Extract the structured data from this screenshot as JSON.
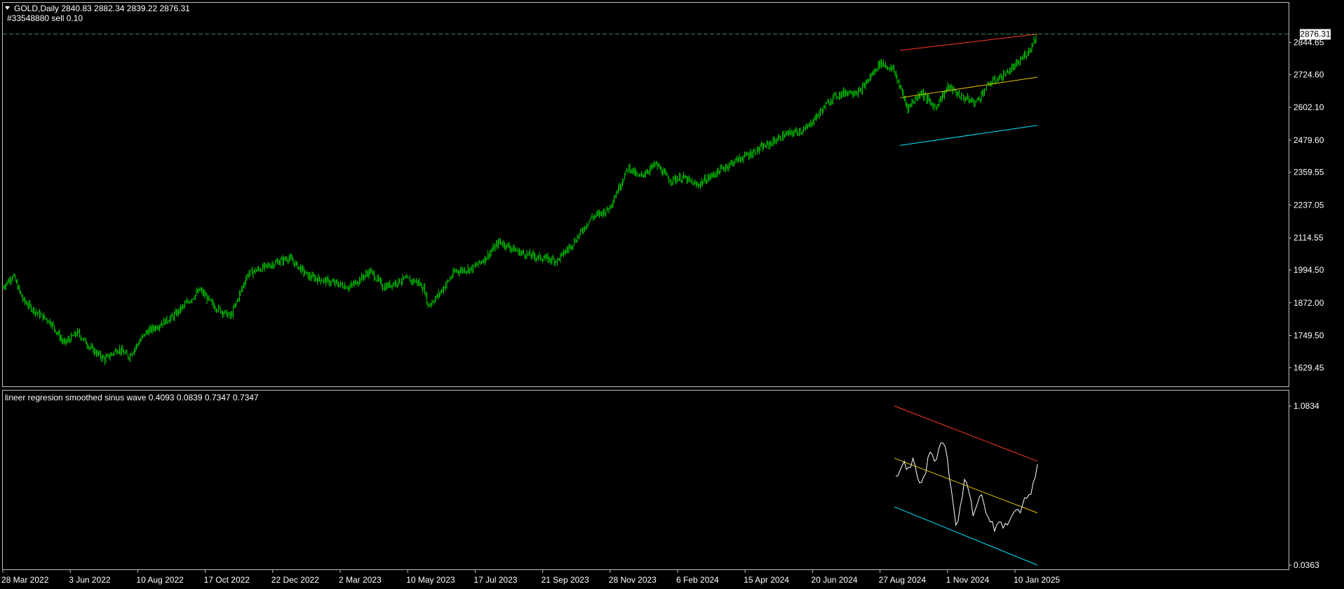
{
  "colors": {
    "background": "#000000",
    "frame": "#c0c0c0",
    "candles": "#00c800",
    "upper_line": "#ff3b1f",
    "middle_line": "#e6c300",
    "lower_line": "#00e5ff",
    "oscillator": "#ffffff",
    "price_line": "#2e8b57",
    "text": "#ffffff"
  },
  "header": {
    "symbol_line": "GOLD,Daily  2840.83 2882.34 2839.22 2876.31",
    "order_line": "#33548880 sell 0.10",
    "menu_icon": "triangle-down-icon"
  },
  "indicator": {
    "title": "lineer regresion smoothed sinus wave 0.4093 0.0839 0.7347 0.7347"
  },
  "current_price_label": "2876.31",
  "chart_data": [
    {
      "type": "candlestick",
      "symbol": "GOLD",
      "timeframe": "Daily",
      "ylim": [
        1570,
        2930
      ],
      "y_ticks": [
        "2844.65",
        "2724.60",
        "2602.10",
        "2479.60",
        "2359.55",
        "2237.05",
        "2114.55",
        "1994.50",
        "1872.00",
        "1749.50",
        "1629.45"
      ],
      "x_tick_labels": [
        "28 Mar 2022",
        "3 Jun 2022",
        "10 Aug 2022",
        "17 Oct 2022",
        "22 Dec 2022",
        "2 Mar 2023",
        "10 May 2023",
        "17 Jul 2023",
        "21 Sep 2023",
        "28 Nov 2023",
        "6 Feb 2024",
        "15 Apr 2024",
        "20 Jun 2024",
        "27 Aug 2024",
        "1 Nov 2024",
        "10 Jan 2025"
      ],
      "last_price": 2876.31,
      "close_series_x": [
        "28 Mar 2022",
        "3 Jun 2022",
        "10 Aug 2022",
        "17 Oct 2022",
        "22 Dec 2022",
        "2 Mar 2023",
        "10 May 2023",
        "17 Jul 2023",
        "21 Sep 2023",
        "28 Nov 2023",
        "6 Feb 2024",
        "15 Apr 2024",
        "20 Jun 2024",
        "27 Aug 2024",
        "1 Nov 2024",
        "10 Jan 2025"
      ],
      "close_points": [
        [
          0,
          1930
        ],
        [
          0.03,
          1975
        ],
        [
          0.06,
          1880
        ],
        [
          0.1,
          1835
        ],
        [
          0.14,
          1800
        ],
        [
          0.18,
          1720
        ],
        [
          0.22,
          1760
        ],
        [
          0.26,
          1700
        ],
        [
          0.3,
          1660
        ],
        [
          0.34,
          1700
        ],
        [
          0.37,
          1670
        ],
        [
          0.42,
          1760
        ],
        [
          0.5,
          1820
        ],
        [
          0.58,
          1920
        ],
        [
          0.62,
          1860
        ],
        [
          0.67,
          1820
        ],
        [
          0.72,
          1980
        ],
        [
          0.78,
          2010
        ],
        [
          0.84,
          2040
        ],
        [
          0.9,
          1970
        ],
        [
          0.96,
          1950
        ],
        [
          1.02,
          1930
        ],
        [
          1.08,
          1990
        ],
        [
          1.12,
          1930
        ],
        [
          1.18,
          1960
        ],
        [
          1.22,
          1950
        ],
        [
          1.24,
          1920
        ],
        [
          1.25,
          1860
        ],
        [
          1.28,
          1900
        ],
        [
          1.33,
          1990
        ],
        [
          1.38,
          2000
        ],
        [
          1.42,
          2040
        ],
        [
          1.46,
          2100
        ],
        [
          1.52,
          2060
        ],
        [
          1.58,
          2040
        ],
        [
          1.63,
          2030
        ],
        [
          1.68,
          2100
        ],
        [
          1.73,
          2190
        ],
        [
          1.78,
          2220
        ],
        [
          1.81,
          2300
        ],
        [
          1.84,
          2380
        ],
        [
          1.87,
          2340
        ],
        [
          1.92,
          2390
        ],
        [
          1.96,
          2330
        ],
        [
          2.0,
          2340
        ],
        [
          2.04,
          2310
        ],
        [
          2.1,
          2360
        ],
        [
          2.15,
          2400
        ],
        [
          2.2,
          2430
        ],
        [
          2.26,
          2470
        ],
        [
          2.3,
          2500
        ],
        [
          2.36,
          2520
        ],
        [
          2.4,
          2580
        ],
        [
          2.44,
          2640
        ],
        [
          2.48,
          2660
        ],
        [
          2.52,
          2660
        ],
        [
          2.58,
          2770
        ],
        [
          2.62,
          2740
        ],
        [
          2.66,
          2600
        ],
        [
          2.7,
          2660
        ],
        [
          2.74,
          2600
        ],
        [
          2.78,
          2680
        ],
        [
          2.82,
          2640
        ],
        [
          2.86,
          2620
        ],
        [
          2.9,
          2690
        ],
        [
          2.94,
          2720
        ],
        [
          2.98,
          2760
        ],
        [
          3.02,
          2820
        ],
        [
          3.04,
          2876.31
        ]
      ]
    },
    {
      "type": "line",
      "name": "lineer regresion smoothed sinus wave",
      "ylim": [
        0.0363,
        1.0834
      ],
      "y_ticks": [
        "1.0834",
        "0.0363"
      ],
      "x_start_label": "27 Aug 2024",
      "x_end_label": "10 Jan 2025",
      "values": [
        0.62,
        0.66,
        0.72,
        0.68,
        0.74,
        0.62,
        0.58,
        0.64,
        0.78,
        0.72,
        0.8,
        0.84,
        0.74,
        0.52,
        0.3,
        0.42,
        0.6,
        0.52,
        0.36,
        0.44,
        0.5,
        0.38,
        0.32,
        0.26,
        0.32,
        0.28,
        0.3,
        0.36,
        0.4,
        0.38,
        0.48,
        0.5,
        0.58,
        0.7
      ],
      "regression_lines": {
        "upper": [
          1.0834,
          0.72
        ],
        "middle": [
          0.74,
          0.38
        ],
        "lower": [
          0.42,
          0.0363
        ]
      }
    }
  ]
}
